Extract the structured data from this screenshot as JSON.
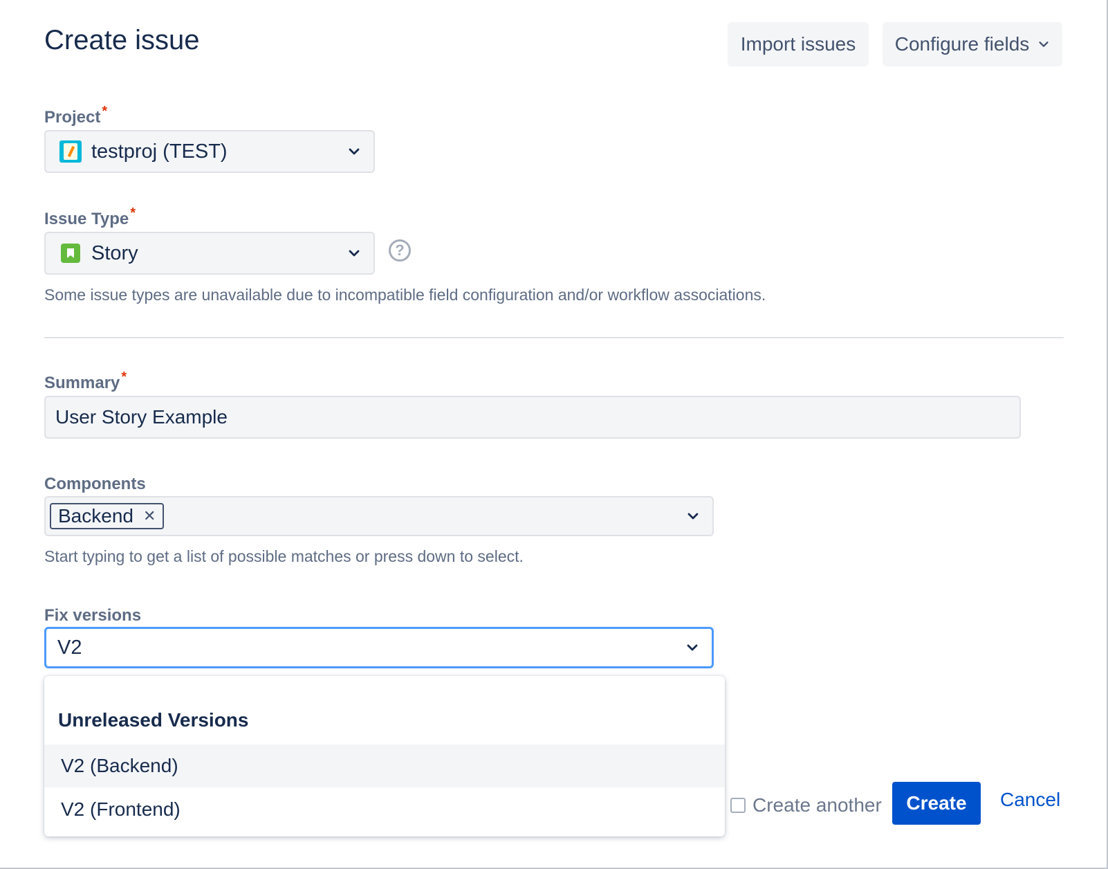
{
  "dialog": {
    "title": "Create issue",
    "import_label": "Import issues",
    "configure_label": "Configure fields"
  },
  "project": {
    "label": "Project",
    "value": "testproj (TEST)"
  },
  "issue_type": {
    "label": "Issue Type",
    "value": "Story",
    "hint": "Some issue types are unavailable due to incompatible field configuration and/or workflow associations."
  },
  "summary": {
    "label": "Summary",
    "value": "User Story Example"
  },
  "components": {
    "label": "Components",
    "tags": [
      "Backend"
    ],
    "hint": "Start typing to get a list of possible matches or press down to select."
  },
  "fix_versions": {
    "label": "Fix versions",
    "value": "V2",
    "dropdown": {
      "group": "Unreleased Versions",
      "items": [
        "V2 (Backend)",
        "V2 (Frontend)"
      ]
    }
  },
  "footer": {
    "create_another": "Create another",
    "create": "Create",
    "cancel": "Cancel"
  },
  "required_mark": "*",
  "colors": {
    "primary": "#0052cc",
    "focus_border": "#4c9aff",
    "required": "#de350b",
    "story_icon": "#63ba3c"
  },
  "icons": {
    "chevron": "chevron-down-icon",
    "help": "question-circle-icon",
    "close": "close-icon"
  }
}
